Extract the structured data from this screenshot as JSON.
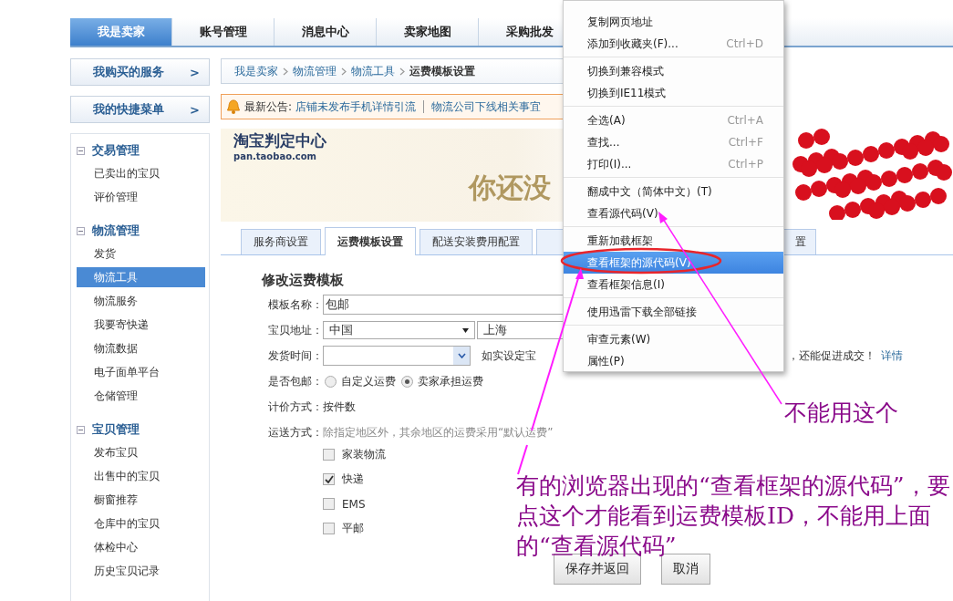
{
  "top_nav": [
    {
      "label": "我是卖家",
      "selected": true
    },
    {
      "label": "账号管理",
      "selected": false
    },
    {
      "label": "消息中心",
      "selected": false
    },
    {
      "label": "卖家地图",
      "selected": false
    },
    {
      "label": "采购批发",
      "selected": false
    }
  ],
  "sidebar": {
    "shortcuts": [
      {
        "label": "我购买的服务",
        "arrow": ">"
      },
      {
        "label": "我的快捷菜单",
        "arrow": ">"
      }
    ],
    "sections": [
      {
        "title": "交易管理",
        "expanded": true,
        "items": [
          {
            "label": "已卖出的宝贝",
            "selected": false
          },
          {
            "label": "评价管理",
            "selected": false
          }
        ]
      },
      {
        "title": "物流管理",
        "expanded": true,
        "items": [
          {
            "label": "发货",
            "selected": false
          },
          {
            "label": "物流工具",
            "selected": true
          },
          {
            "label": "物流服务",
            "selected": false
          },
          {
            "label": "我要寄快递",
            "selected": false
          },
          {
            "label": "物流数据",
            "selected": false
          },
          {
            "label": "电子面单平台",
            "selected": false
          },
          {
            "label": "仓储管理",
            "selected": false
          }
        ]
      },
      {
        "title": "宝贝管理",
        "expanded": true,
        "items": [
          {
            "label": "发布宝贝",
            "selected": false
          },
          {
            "label": "出售中的宝贝",
            "selected": false
          },
          {
            "label": "橱窗推荐",
            "selected": false
          },
          {
            "label": "仓库中的宝贝",
            "selected": false
          },
          {
            "label": "体检中心",
            "selected": false
          },
          {
            "label": "历史宝贝记录",
            "selected": false
          }
        ]
      }
    ]
  },
  "breadcrumb": [
    "我是卖家",
    "物流管理",
    "物流工具",
    "运费模板设置"
  ],
  "notice": {
    "label": "最新公告:",
    "links": [
      "店铺未发布手机详情引流",
      "物流公司下线相关事宜"
    ]
  },
  "banner": {
    "logo": "淘宝判定中心",
    "logo_url": "pan.taobao.com",
    "headline": "你还没"
  },
  "sub_tabs": [
    {
      "label": "服务商设置",
      "selected": false
    },
    {
      "label": "运费模板设置",
      "selected": true
    },
    {
      "label": "配送安装费用配置",
      "selected": false
    },
    {
      "label": "置",
      "selected": false
    }
  ],
  "form": {
    "title": "修改运费模板",
    "fields": [
      {
        "kind": "text",
        "label": "模板名称：",
        "value": "包邮"
      },
      {
        "kind": "selects",
        "label": "宝贝地址：",
        "selects": [
          "中国",
          "上海"
        ]
      },
      {
        "kind": "select_hint",
        "label": "发货时间：",
        "hint_before": "如实设定宝",
        "hint_after": "，还能促进成交！",
        "link": "详情"
      },
      {
        "kind": "radios",
        "label": "是否包邮：",
        "options": [
          {
            "label": "自定义运费",
            "selected": false
          },
          {
            "label": "卖家承担运费",
            "selected": true
          }
        ]
      },
      {
        "kind": "static",
        "label": "计价方式：",
        "value": "按件数"
      },
      {
        "kind": "checks",
        "label": "运送方式：",
        "note": "除指定地区外，其余地区的运费采用“默认运费”",
        "options": [
          {
            "label": "家装物流",
            "checked": false
          },
          {
            "label": "快递",
            "checked": true
          },
          {
            "label": "EMS",
            "checked": false
          },
          {
            "label": "平邮",
            "checked": false
          }
        ]
      }
    ]
  },
  "buttons": [
    "保存并返回",
    "取消"
  ],
  "context_menu": {
    "groups": [
      [
        {
          "label": "复制网页地址",
          "selected": false
        },
        {
          "label": "添加到收藏夹(F)...",
          "shortcut": "Ctrl+D",
          "selected": false
        }
      ],
      [
        {
          "label": "切换到兼容模式",
          "selected": false
        },
        {
          "label": "切换到IE11模式",
          "selected": false
        }
      ],
      [
        {
          "label": "全选(A)",
          "shortcut": "Ctrl+A",
          "selected": false
        },
        {
          "label": "查找...",
          "shortcut": "Ctrl+F",
          "selected": false
        },
        {
          "label": "打印(I)...",
          "shortcut": "Ctrl+P",
          "selected": false
        }
      ],
      [
        {
          "label": "翻成中文（简体中文）(T)",
          "selected": false
        },
        {
          "label": "查看源代码(V)",
          "selected": false
        }
      ],
      [
        {
          "label": "重新加载框架",
          "selected": false
        },
        {
          "label": "查看框架的源代码(V)",
          "selected": true
        },
        {
          "label": "查看框架信息(I)",
          "selected": false
        }
      ],
      [
        {
          "label": "使用迅雷下载全部链接",
          "selected": false
        }
      ],
      [
        {
          "label": "审查元素(W)",
          "selected": false
        },
        {
          "label": "属性(P)",
          "selected": false
        }
      ]
    ]
  },
  "annotations": [
    "不能用这个",
    "有的浏览器出现的“查看框架的源代码”，要点这个才能看到运费模板ID，不能用上面的“查看源代码”"
  ]
}
